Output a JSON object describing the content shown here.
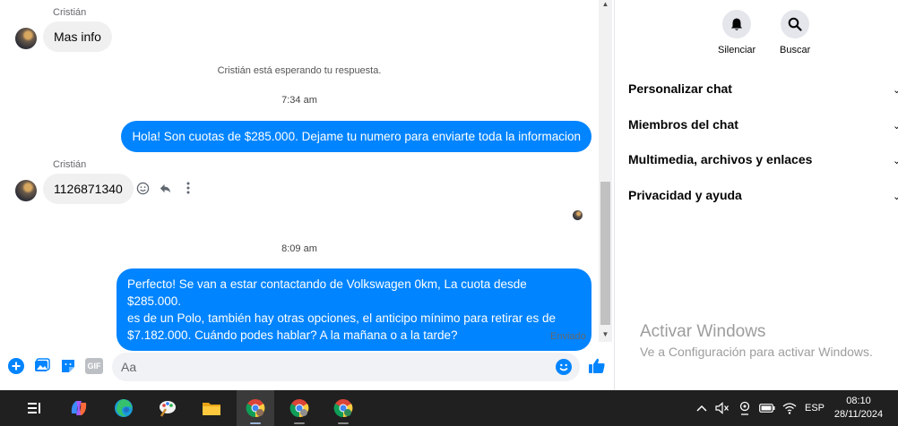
{
  "conversation": {
    "contact_name_1": "Cristián",
    "msg_in_1": "Mas info",
    "waiting_note": "Cristián está esperando tu respuesta.",
    "time_1": "7:34 am",
    "msg_out_1": "Hola! Son cuotas de $285.000. Dejame tu numero para enviarte toda la informacion",
    "contact_name_2": "Cristián",
    "msg_in_2": "1126871340",
    "time_2": "8:09 am",
    "msg_out_2_line1": "Perfecto!  Se van a estar contactando de Volkswagen 0km, La cuota desde $285.000.",
    "msg_out_2_line2": "es de un Polo, también hay otras opciones, el anticipo mínimo para retirar es de",
    "msg_out_2_line3": "$7.182.000. Cuándo podes hablar? A la mañana o a la tarde?",
    "sent_status": "Enviado"
  },
  "composer": {
    "placeholder": "Aa",
    "gif_label": "GIF"
  },
  "side_panel": {
    "mute_label": "Silenciar",
    "search_label": "Buscar",
    "sections": [
      "Personalizar chat",
      "Miembros del chat",
      "Multimedia, archivos y enlaces",
      "Privacidad y ayuda"
    ]
  },
  "watermark": {
    "title": "Activar Windows",
    "subtitle": "Ve a Configuración para activar Windows."
  },
  "taskbar": {
    "lang": "ESP",
    "time": "08:10",
    "date": "28/11/2024"
  },
  "colors": {
    "accent": "#0084ff",
    "incoming_bubble": "#f0f0f0",
    "taskbar": "#202020"
  }
}
